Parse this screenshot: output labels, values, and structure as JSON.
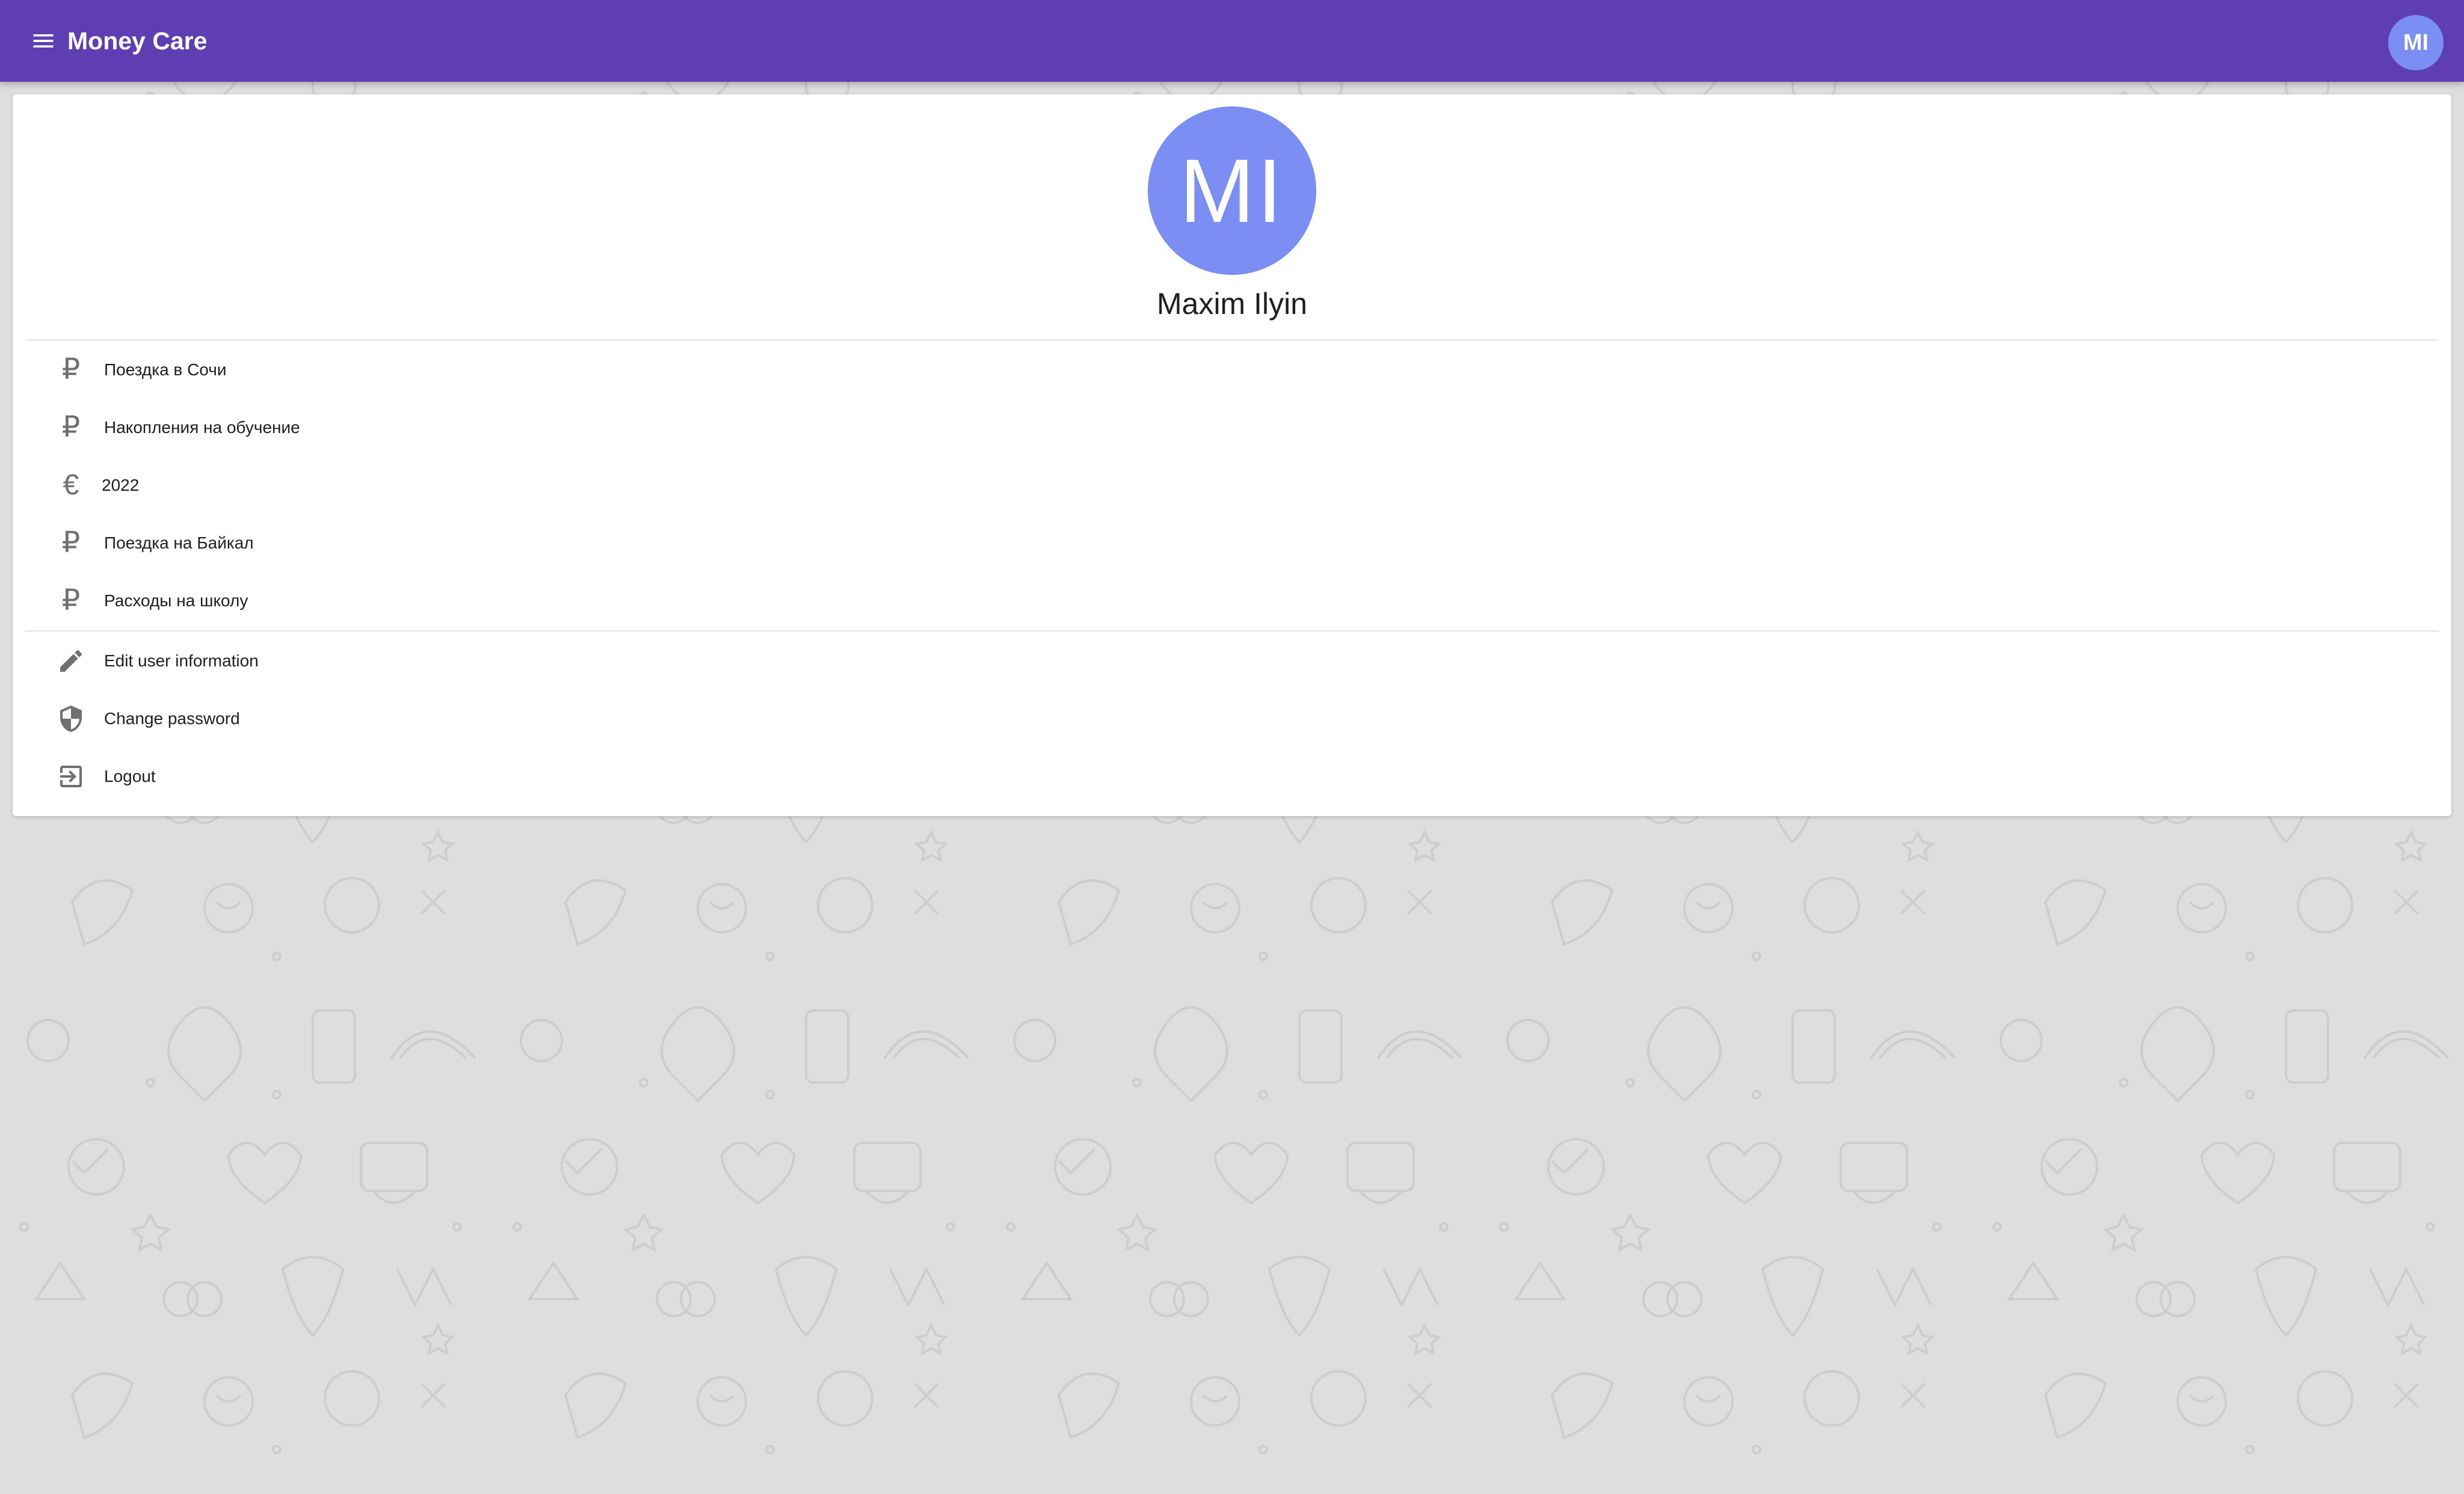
{
  "appbar": {
    "title": "Money Care",
    "menu_icon": "menu-icon",
    "avatar_initials": "MI",
    "color": "#5e3eb2"
  },
  "profile": {
    "initials": "MI",
    "name": "Maxim Ilyin",
    "avatar_color": "#7b8ef3"
  },
  "accounts": [
    {
      "currency_symbol": "₽",
      "icon": "ruble-icon",
      "label": "Поездка в Сочи"
    },
    {
      "currency_symbol": "₽",
      "icon": "ruble-icon",
      "label": "Накопления на обучение"
    },
    {
      "currency_symbol": "€",
      "icon": "euro-icon",
      "label": "2022"
    },
    {
      "currency_symbol": "₽",
      "icon": "ruble-icon",
      "label": "Поездка на Байкал"
    },
    {
      "currency_symbol": "₽",
      "icon": "ruble-icon",
      "label": "Расходы на школу"
    }
  ],
  "actions": [
    {
      "icon": "pencil-icon",
      "label": "Edit user information"
    },
    {
      "icon": "shield-icon",
      "label": "Change password"
    },
    {
      "icon": "logout-icon",
      "label": "Logout"
    }
  ]
}
